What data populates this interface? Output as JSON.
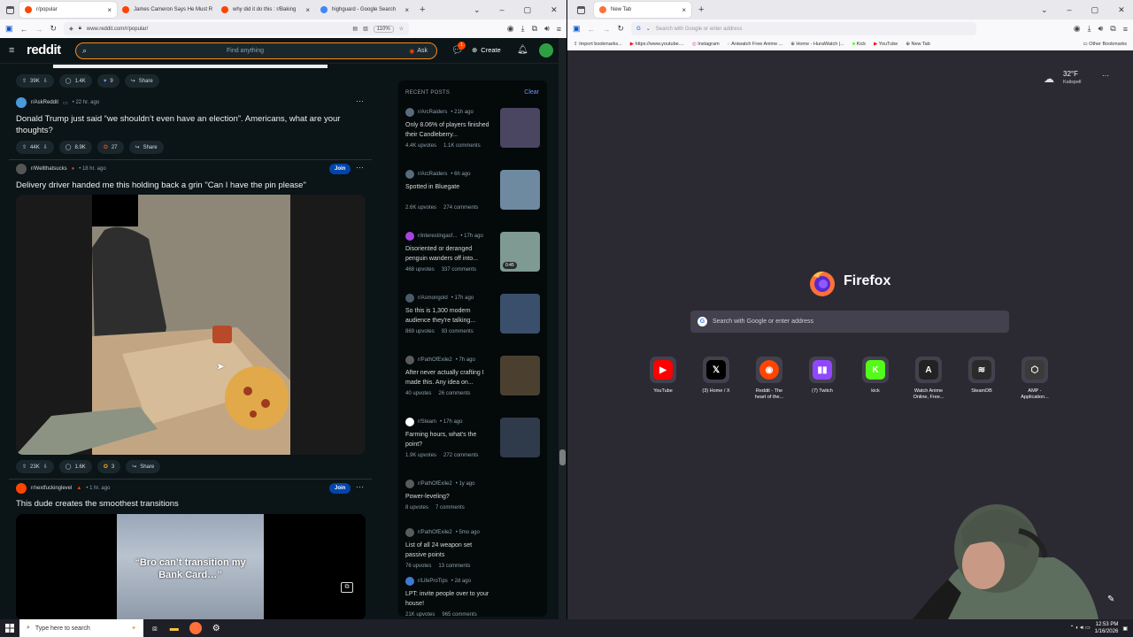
{
  "left_browser": {
    "tabs": [
      {
        "label": "r/popular",
        "color": "#ff4500"
      },
      {
        "label": "James Cameron Says He Must R",
        "color": "#ff4500"
      },
      {
        "label": "why did it do this : r/Baking",
        "color": "#ff4500"
      },
      {
        "label": "highguard - Google Search",
        "color": "#4285f4"
      }
    ],
    "url": "www.reddit.com/r/popular/",
    "zoom": "110%"
  },
  "reddit": {
    "logo": "reddit",
    "search_placeholder": "Find anything",
    "ask_label": "Ask",
    "create_label": "Create",
    "chat_badge": "1",
    "posts": [
      {
        "votes": "39K",
        "comments": "1.4K",
        "awards": "9",
        "share": "Share"
      },
      {
        "subreddit": "r/AskReddit",
        "time": "• 22 hr. ago",
        "title": "Donald Trump just said “we shouldn’t even have an election”. Americans, what are your thoughts?",
        "votes": "44K",
        "comments": "8.9K",
        "awards": "27",
        "share": "Share"
      },
      {
        "subreddit": "r/Wellthatsucks",
        "time": "• 18 hr. ago",
        "join": "Join",
        "title": "Delivery driver handed me this holding back a grin \"Can I have the pin please\"",
        "votes": "23K",
        "comments": "1.6K",
        "awards": "3",
        "share": "Share"
      },
      {
        "subreddit": "r/nextfuckinglevel",
        "time": "• 1 hr. ago",
        "join": "Join",
        "title": "This dude creates the smoothest transitions",
        "caption": "“Bro can’t transition my Bank Card…”"
      }
    ],
    "recent_header": "RECENT POSTS",
    "recent_clear": "Clear",
    "recent": [
      {
        "sub": "r/ArcRaiders",
        "time": "• 21h ago",
        "title": "Only 8.06% of players finished their Candleberry...",
        "upvotes": "4.4K upvotes",
        "comments": "1.1K comments",
        "thumb": "#4a4560",
        "sub_color": "#5a6b7b"
      },
      {
        "sub": "r/ArcRaiders",
        "time": "• 6h ago",
        "title": "Spotted in Bluegate",
        "upvotes": "2.6K upvotes",
        "comments": "274 comments",
        "thumb": "#6d8aa0",
        "sub_color": "#5a6b7b"
      },
      {
        "sub": "r/interestingasf...",
        "time": "• 17h ago",
        "title": "Disoriented or deranged penguin wanders off into...",
        "upvotes": "468 upvotes",
        "comments": "337 comments",
        "thumb": "#7e9a92",
        "duration": "0:45",
        "sub_color": "#a742e0"
      },
      {
        "sub": "r/Asmongold",
        "time": "• 17h ago",
        "title": "So this is 1,300 modern audience they're talking...",
        "upvotes": "869 upvotes",
        "comments": "93 comments",
        "thumb": "#3a4f6b",
        "sub_color": "#4a5b6b"
      },
      {
        "sub": "r/PathOfExile2",
        "time": "• 7h ago",
        "title": "After never actually crafting I made this. Any idea on...",
        "upvotes": "40 upvotes",
        "comments": "26 comments",
        "thumb": "#4b4030",
        "sub_color": "#5b5b5b"
      },
      {
        "sub": "r/Steam",
        "time": "• 17h ago",
        "title": "Farming hours, what's the point?",
        "upvotes": "1.9K upvotes",
        "comments": "272 comments",
        "thumb": "#2f3a4a",
        "sub_color": "#ffffff"
      },
      {
        "sub": "r/PathOfExile2",
        "time": "• 1y ago",
        "title": "Power-leveling?",
        "upvotes": "8 upvotes",
        "comments": "7 comments",
        "sub_color": "#5b5b5b"
      },
      {
        "sub": "r/PathOfExile2",
        "time": "• 5mo ago",
        "title": "List of all 24 weapon set passive points",
        "upvotes": "76 upvotes",
        "comments": "13 comments",
        "sub_color": "#5b5b5b"
      },
      {
        "sub": "r/LifeProTips",
        "time": "• 2d ago",
        "title": "LPT: invite people over to your house!",
        "upvotes": "21K upvotes",
        "comments": "965 comments",
        "sub_color": "#3d7bd1"
      }
    ]
  },
  "right_browser": {
    "tab": "New Tab",
    "address_placeholder": "Search with Google or enter address",
    "bookmarks": [
      "Import bookmarks...",
      "https://www.youtube....",
      "Instagram",
      "Aniwatch Free Anime ...",
      "Home - HuraWatch |...",
      "Kick",
      "YouTube",
      "New Tab"
    ],
    "other_bookmarks": "Other Bookmarks",
    "weather_temp": "32°F",
    "weather_city": "Kalispell",
    "firefox_label": "Firefox",
    "search_placeholder": "Search with Google or enter address",
    "shortcuts": [
      {
        "label": "YouTube",
        "icon": "youtube-icon",
        "color": "#ff0000"
      },
      {
        "label": "(3) Home / X",
        "icon": "x-icon",
        "color": "#000000"
      },
      {
        "label": "Reddit - The heart of the...",
        "icon": "reddit-icon",
        "color": "#ff4500"
      },
      {
        "label": "(7) Twitch",
        "icon": "twitch-icon",
        "color": "#9146ff"
      },
      {
        "label": "kick",
        "icon": "kick-icon",
        "color": "#53fc18"
      },
      {
        "label": "Watch Anime Online, Free...",
        "icon": "anime-icon",
        "color": "#222222"
      },
      {
        "label": "SteamDB",
        "icon": "steamdb-icon",
        "color": "#2a2a2a"
      },
      {
        "label": "AMP - Application...",
        "icon": "amp-icon",
        "color": "#3a3a3a"
      }
    ]
  },
  "taskbar": {
    "search_placeholder": "Type here to search",
    "time": "12:53 PM",
    "date": "1/16/2026"
  }
}
